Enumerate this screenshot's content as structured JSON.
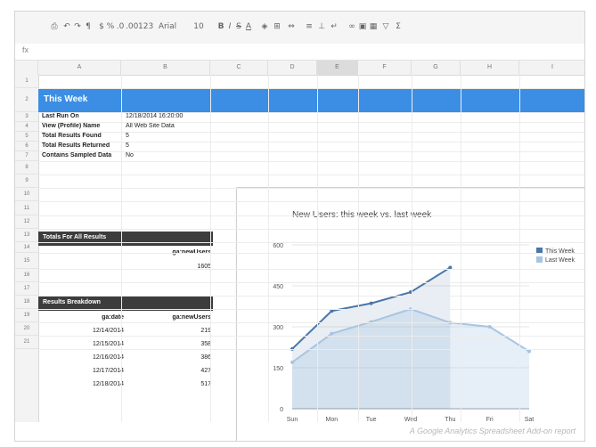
{
  "toolbar": {
    "icons": [
      "print-icon",
      "undo-icon",
      "redo-icon",
      "paint-format-icon",
      "currency-icon",
      "percent-icon",
      "decimal-decrease-icon",
      "decimal-increase-icon",
      "number-format-icon",
      "font-icon",
      "font-size-icon",
      "bold-icon",
      "italic-icon",
      "strikethrough-icon",
      "text-color-icon",
      "fill-color-icon",
      "borders-icon",
      "merge-icon",
      "align-icon",
      "valign-icon",
      "wrap-icon",
      "link-icon",
      "comment-icon",
      "chart-icon",
      "filter-icon",
      "functions-icon"
    ],
    "font_label": "Arial",
    "size_label": "10"
  },
  "formula_bar": {
    "fx_label": "fx"
  },
  "columns": [
    "A",
    "B",
    "C",
    "D",
    "E",
    "F",
    "G",
    "H",
    "I"
  ],
  "selected_column": "E",
  "rows": [
    "1",
    "2",
    "3",
    "4",
    "5",
    "6",
    "7",
    "8",
    "9",
    "10",
    "11",
    "12",
    "13",
    "14",
    "15",
    "16",
    "17",
    "18",
    "19",
    "20",
    "21"
  ],
  "banner": {
    "title": "This Week"
  },
  "report_info": [
    {
      "label": "Last Run On",
      "value": "12/18/2014 16:20:00"
    },
    {
      "label": "View (Profile) Name",
      "value": "All Web Site Data"
    },
    {
      "label": "Total Results Found",
      "value": "5"
    },
    {
      "label": "Total Results Returned",
      "value": "5"
    },
    {
      "label": "Contains Sampled Data",
      "value": "No"
    }
  ],
  "totals": {
    "title": "Totals For All Results",
    "header": "ga:newUsers",
    "value": "1605"
  },
  "breakdown": {
    "title": "Results Breakdown",
    "headers": [
      "ga:date",
      "ga:newUsers"
    ],
    "rows": [
      [
        "12/14/2014",
        "219"
      ],
      [
        "12/15/2014",
        "358"
      ],
      [
        "12/16/2014",
        "386"
      ],
      [
        "12/17/2014",
        "427"
      ],
      [
        "12/18/2014",
        "517"
      ]
    ]
  },
  "chart_data": {
    "type": "area",
    "title": "New Users: this week vs. last week",
    "categories": [
      "Sun",
      "Mon",
      "Tue",
      "Wed",
      "Thu",
      "Fri",
      "Sat"
    ],
    "series": [
      {
        "name": "This Week",
        "values": [
          219,
          358,
          386,
          427,
          517,
          null,
          null
        ]
      },
      {
        "name": "Last Week",
        "values": [
          170,
          275,
          318,
          365,
          315,
          300,
          210
        ]
      }
    ],
    "yticks": [
      0,
      150,
      300,
      450,
      600
    ],
    "ylim": [
      0,
      600
    ],
    "legend": "right",
    "colors": {
      "this_week": "#4a76a8",
      "last_week": "#a7c5e2"
    }
  },
  "footer": {
    "text": "A Google Analytics Spreadsheet Add-on report"
  }
}
